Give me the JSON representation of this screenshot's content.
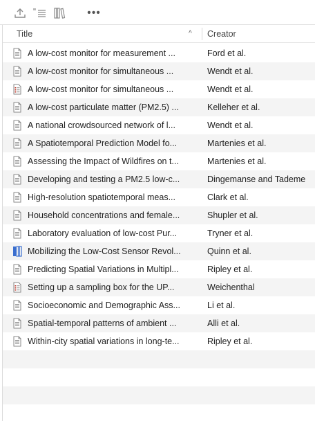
{
  "toolbar": {
    "buttons": [
      {
        "name": "upload-icon"
      },
      {
        "name": "notes-icon"
      },
      {
        "name": "library-icon"
      },
      {
        "name": "more-icon",
        "glyph": "•••"
      }
    ]
  },
  "columns": {
    "title": "Title",
    "creator": "Creator",
    "sort_glyph": "^"
  },
  "colors": {
    "doc_icon": "#8a8a8a",
    "book_icon": "#3b6fcf",
    "report_icon": "#c0392b",
    "alt_row": "#f4f4f4"
  },
  "rows": [
    {
      "title": "A low-cost monitor for measurement ...",
      "creator": "Ford et al.",
      "icon": "document-icon"
    },
    {
      "title": "A low-cost monitor for simultaneous ...",
      "creator": "Wendt et al.",
      "icon": "document-icon"
    },
    {
      "title": "A low-cost monitor for simultaneous ...",
      "creator": "Wendt et al.",
      "icon": "report-icon"
    },
    {
      "title": "A low-cost particulate matter (PM2.5) ...",
      "creator": "Kelleher et al.",
      "icon": "document-icon"
    },
    {
      "title": "A national crowdsourced network of l...",
      "creator": "Wendt et al.",
      "icon": "document-icon"
    },
    {
      "title": "A Spatiotemporal Prediction Model fo...",
      "creator": "Martenies et al.",
      "icon": "document-icon"
    },
    {
      "title": "Assessing the Impact of Wildfires on t...",
      "creator": "Martenies et al.",
      "icon": "document-icon"
    },
    {
      "title": "Developing and testing a PM2.5 low-c...",
      "creator": "Dingemanse and Tademe",
      "icon": "document-icon"
    },
    {
      "title": "High-resolution spatiotemporal meas...",
      "creator": "Clark et al.",
      "icon": "document-icon"
    },
    {
      "title": "Household concentrations and female...",
      "creator": "Shupler et al.",
      "icon": "document-icon"
    },
    {
      "title": "Laboratory evaluation of low-cost Pur...",
      "creator": "Tryner et al.",
      "icon": "document-icon"
    },
    {
      "title": "Mobilizing the Low-Cost Sensor Revol...",
      "creator": "Quinn et al.",
      "icon": "book-icon"
    },
    {
      "title": "Predicting Spatial Variations in Multipl...",
      "creator": "Ripley et al.",
      "icon": "document-icon"
    },
    {
      "title": "Setting up a sampling box for the UP...",
      "creator": "Weichenthal",
      "icon": "report-icon"
    },
    {
      "title": "Socioeconomic and Demographic Ass...",
      "creator": "Li et al.",
      "icon": "document-icon"
    },
    {
      "title": "Spatial-temporal patterns of ambient ...",
      "creator": "Alli et al.",
      "icon": "document-icon"
    },
    {
      "title": "Within-city spatial variations in long-te...",
      "creator": "Ripley et al.",
      "icon": "document-icon"
    }
  ]
}
